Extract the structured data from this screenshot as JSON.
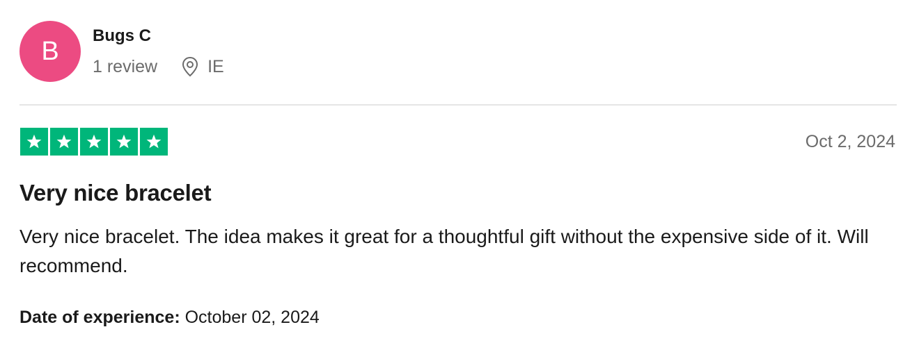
{
  "reviewer": {
    "avatar_initial": "B",
    "avatar_color": "#ec4b82",
    "name": "Bugs C",
    "review_count": "1 review",
    "location_icon": "map-pin-icon",
    "country": "IE"
  },
  "review": {
    "rating": 5,
    "rating_max": 5,
    "star_color": "#00b67a",
    "date": "Oct 2, 2024",
    "title": "Very nice bracelet",
    "body": "Very nice bracelet. The idea makes it great for a thoughtful gift without the expensive side of it. Will recommend.",
    "experience_label": "Date of experience:",
    "experience_date": "October 02, 2024"
  }
}
